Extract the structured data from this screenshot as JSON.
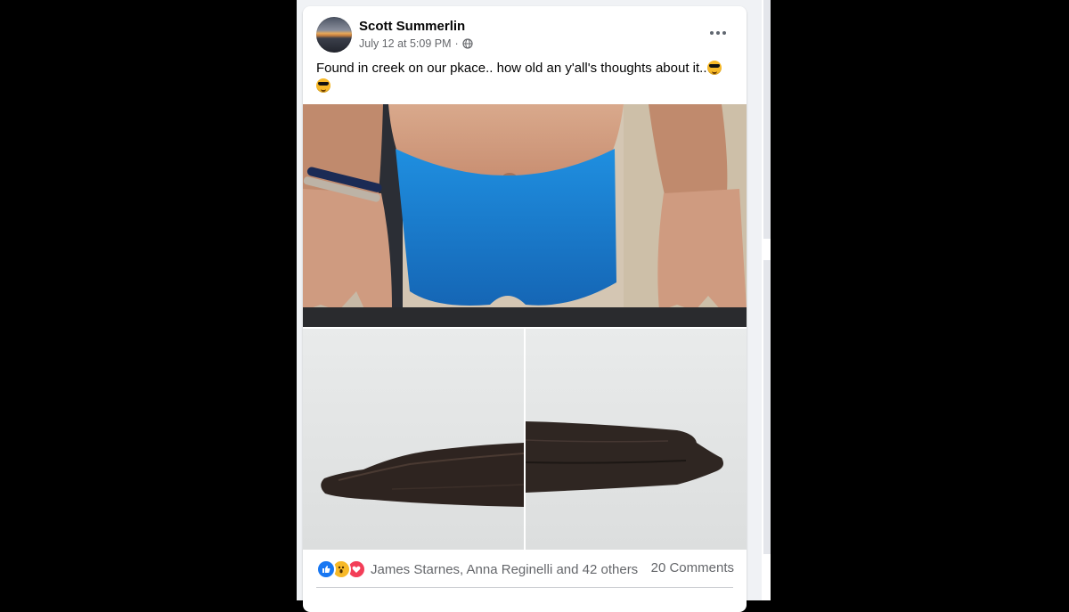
{
  "post": {
    "author": "Scott Summerlin",
    "timestamp": "July 12 at 5:09 PM",
    "separator": "·",
    "privacy_icon": "globe-icon",
    "more_icon": "ellipsis-icon",
    "text": "Found in creek on our pkace.. how old an y'all's  thoughts about it..",
    "text_emoji": "smiling-face-with-sunglasses",
    "photos": [
      {
        "subject": "person-blue-shorts"
      },
      {
        "subject": "dark-wood-artifact-left"
      },
      {
        "subject": "dark-wood-artifact-right"
      }
    ]
  },
  "footer": {
    "reaction_icons": [
      "like-icon",
      "wow-icon",
      "love-icon"
    ],
    "reactions_text": "James Starnes, Anna Reginelli and 42 others",
    "comments_text": "20 Comments"
  },
  "colors": {
    "page_bg": "#000000",
    "feed_bg": "#f0f2f5",
    "card_bg": "#ffffff",
    "text_primary": "#050505",
    "text_secondary": "#65676b",
    "like_blue": "#1877f2",
    "love_red": "#f33e58",
    "wow_yellow": "#f7b928"
  }
}
